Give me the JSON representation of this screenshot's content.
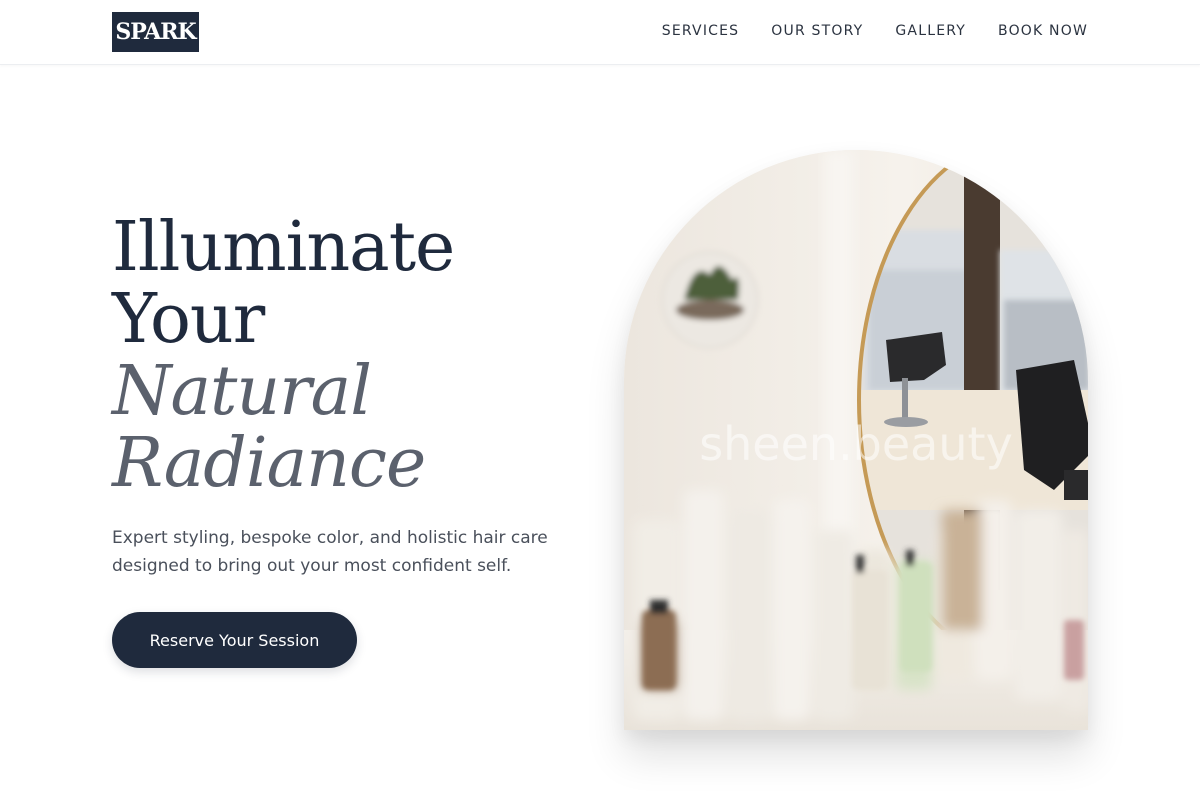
{
  "brand": {
    "logo_text": "SPARK"
  },
  "nav": {
    "items": [
      {
        "label": "SERVICES"
      },
      {
        "label": "OUR STORY"
      },
      {
        "label": "GALLERY"
      },
      {
        "label": "BOOK NOW"
      }
    ]
  },
  "hero": {
    "title_line1": "Illuminate",
    "title_line2": "Your",
    "title_line3": "Natural",
    "title_line4": "Radiance",
    "subtitle": "Expert styling, bespoke color, and holistic hair care designed to bring out your most confident self.",
    "cta_label": "Reserve Your Session",
    "image_watermark": "sheen.beauty"
  },
  "colors": {
    "primary": "#1f2a3d",
    "accent_text": "#5b616d",
    "body_text": "#4a505b",
    "background": "#ffffff"
  }
}
